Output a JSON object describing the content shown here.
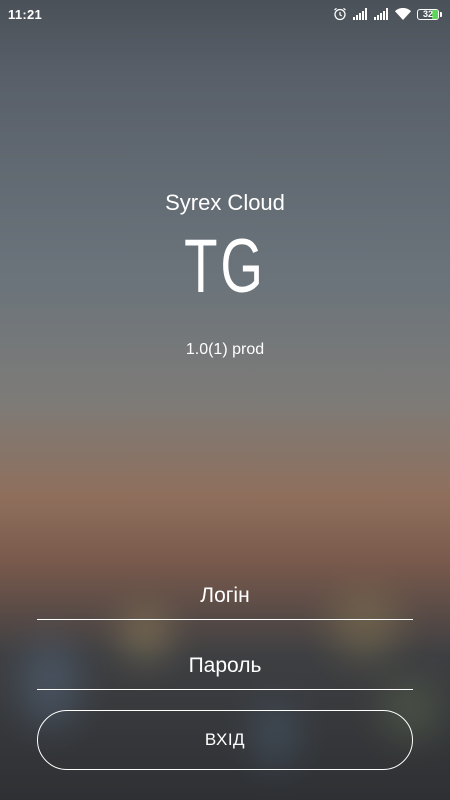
{
  "status_bar": {
    "time": "11:21",
    "icons": [
      "alarm-icon",
      "signal-icon",
      "signal-icon",
      "wifi-icon",
      "battery-icon"
    ],
    "battery_level": "32",
    "battery_color": "#5fd35a"
  },
  "brand": {
    "app_name": "Syrex Cloud",
    "logo_text": "TG",
    "version": "1.0(1) prod"
  },
  "form": {
    "login_placeholder": "Логін",
    "password_placeholder": "Пароль",
    "submit_label": "ВХІД"
  },
  "colors": {
    "text": "#ffffff",
    "accent_battery": "#5fd35a"
  }
}
